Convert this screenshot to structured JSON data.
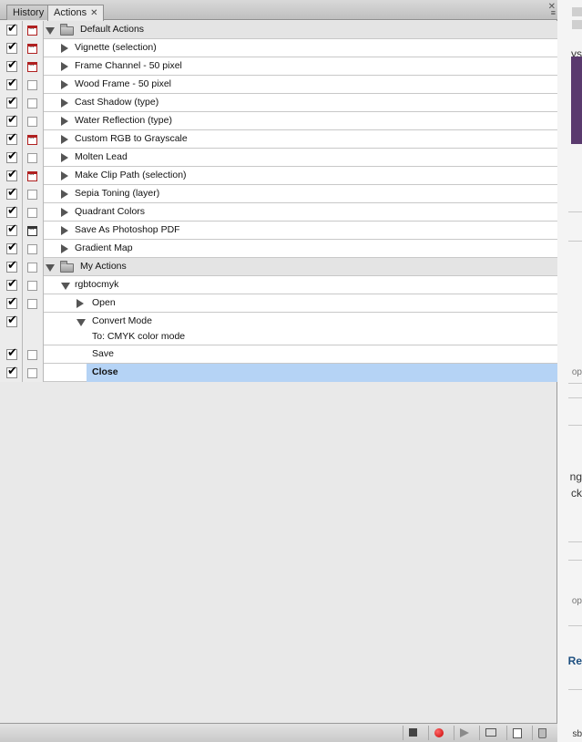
{
  "tabs": [
    {
      "label": "History",
      "active": false
    },
    {
      "label": "Actions",
      "active": true
    }
  ],
  "panel": {
    "close_glyph": "✕",
    "menu_glyph": "≡"
  },
  "rows": [
    {
      "label": "Default Actions",
      "checked": true,
      "dialog": "red",
      "level": 0,
      "kind": "set",
      "expanded": true
    },
    {
      "label": "Vignette (selection)",
      "checked": true,
      "dialog": "red",
      "level": 1,
      "kind": "action",
      "expanded": false
    },
    {
      "label": "Frame Channel - 50 pixel",
      "checked": true,
      "dialog": "red",
      "level": 1,
      "kind": "action",
      "expanded": false
    },
    {
      "label": "Wood Frame - 50 pixel",
      "checked": true,
      "dialog": "empty",
      "level": 1,
      "kind": "action",
      "expanded": false
    },
    {
      "label": "Cast Shadow (type)",
      "checked": true,
      "dialog": "empty",
      "level": 1,
      "kind": "action",
      "expanded": false
    },
    {
      "label": "Water Reflection (type)",
      "checked": true,
      "dialog": "empty",
      "level": 1,
      "kind": "action",
      "expanded": false
    },
    {
      "label": "Custom RGB to Grayscale",
      "checked": true,
      "dialog": "red",
      "level": 1,
      "kind": "action",
      "expanded": false
    },
    {
      "label": "Molten Lead",
      "checked": true,
      "dialog": "empty",
      "level": 1,
      "kind": "action",
      "expanded": false
    },
    {
      "label": "Make Clip Path (selection)",
      "checked": true,
      "dialog": "red",
      "level": 1,
      "kind": "action",
      "expanded": false
    },
    {
      "label": "Sepia Toning (layer)",
      "checked": true,
      "dialog": "empty",
      "level": 1,
      "kind": "action",
      "expanded": false
    },
    {
      "label": "Quadrant Colors",
      "checked": true,
      "dialog": "empty",
      "level": 1,
      "kind": "action",
      "expanded": false
    },
    {
      "label": "Save As Photoshop PDF",
      "checked": true,
      "dialog": "dark",
      "level": 1,
      "kind": "action",
      "expanded": false
    },
    {
      "label": "Gradient Map",
      "checked": true,
      "dialog": "empty",
      "level": 1,
      "kind": "action",
      "expanded": false
    },
    {
      "label": "My Actions",
      "checked": true,
      "dialog": "empty",
      "level": 0,
      "kind": "set",
      "expanded": true
    },
    {
      "label": "rgbtocmyk",
      "checked": true,
      "dialog": "empty",
      "level": 1,
      "kind": "action",
      "expanded": true
    },
    {
      "label": "Open",
      "checked": true,
      "dialog": "empty",
      "level": 2,
      "kind": "step",
      "expanded": false
    },
    {
      "label": "Convert Mode",
      "sublabel": "To: CMYK color mode",
      "checked": true,
      "dialog": "none",
      "level": 2,
      "kind": "step",
      "expanded": true
    },
    {
      "label": "Save",
      "checked": true,
      "dialog": "empty",
      "level": 2,
      "kind": "step",
      "expanded": null
    },
    {
      "label": "Close",
      "checked": true,
      "dialog": "empty",
      "level": 2,
      "kind": "step",
      "expanded": null,
      "selected": true
    }
  ],
  "toolbar": {
    "buttons": [
      {
        "name": "stop-button",
        "icon": "stop-icon"
      },
      {
        "name": "record-button",
        "icon": "record-icon"
      },
      {
        "name": "play-button",
        "icon": "play-icon"
      },
      {
        "name": "new-set-button",
        "icon": "folder-icon"
      },
      {
        "name": "new-action-button",
        "icon": "new-page-icon"
      },
      {
        "name": "delete-button",
        "icon": "trash-icon"
      }
    ]
  },
  "background_window": {
    "fragments": [
      "ys",
      "op",
      "ng",
      "ck",
      "op",
      "Re",
      "sb"
    ]
  },
  "colors": {
    "selection": "#b5d3f5",
    "record": "#c80000",
    "dialog_red": "#b02020"
  }
}
